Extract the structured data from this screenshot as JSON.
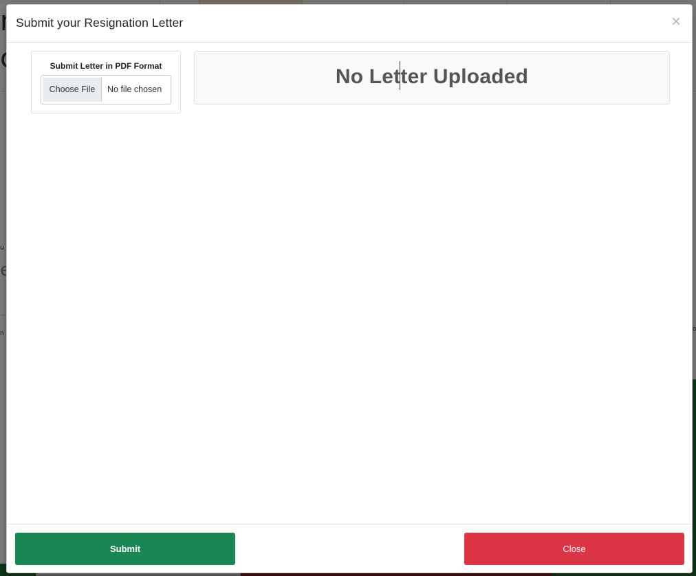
{
  "modal": {
    "title": "Submit your Resignation Letter",
    "close_icon": "×",
    "upload": {
      "label": "Submit Letter in PDF Format",
      "choose_button": "Choose File",
      "file_status": "No file chosen"
    },
    "preview": {
      "message": "No Letter Uploaded"
    },
    "footer": {
      "submit_label": "Submit",
      "close_label": "Close"
    }
  },
  "colors": {
    "submit": "#198754",
    "close": "#dc3545",
    "backdrop": "rgba(0,0,0,0.5)"
  },
  "icons": {
    "close": "close-icon"
  }
}
